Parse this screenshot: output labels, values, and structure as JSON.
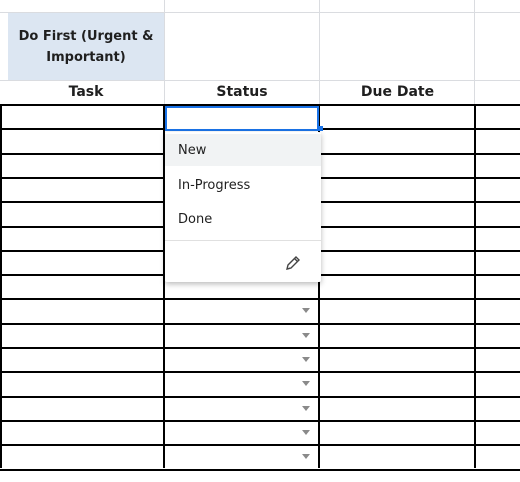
{
  "sheet": {
    "quadrant_title": "Do First (Urgent & Important)",
    "columns": [
      "Task",
      "Status",
      "Due Date"
    ],
    "quadrant_bg": "#dce6f2"
  },
  "editor": {
    "value": ""
  },
  "dropdown": {
    "options": [
      "New",
      "In-Progress",
      "Done"
    ],
    "highlighted": "New",
    "edit_icon": "pencil-icon"
  }
}
